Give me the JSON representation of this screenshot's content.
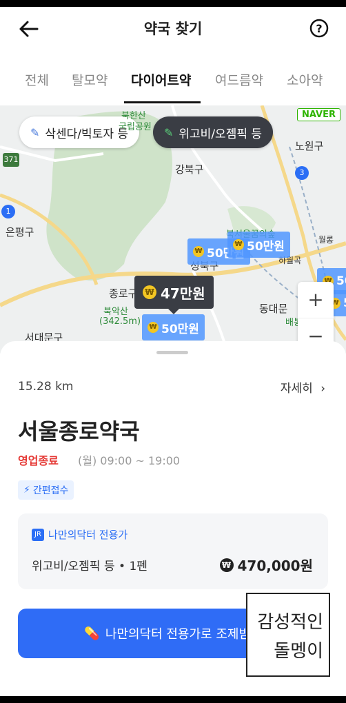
{
  "header": {
    "title": "약국 찾기",
    "back_icon": "arrow-left-icon",
    "help_icon": "question-circle-icon"
  },
  "tabs": [
    {
      "label": "전체",
      "active": false
    },
    {
      "label": "탈모약",
      "active": false
    },
    {
      "label": "다이어트약",
      "active": true
    },
    {
      "label": "여드름약",
      "active": false
    },
    {
      "label": "소아약",
      "active": false
    }
  ],
  "map": {
    "filter_chips": [
      {
        "label": "삭센다/빅토자 등",
        "selected": false
      },
      {
        "label": "위고비/오젬픽 등",
        "selected": true
      }
    ],
    "provider_badge": "NAVER",
    "labels": {
      "gangbuk": "강북구",
      "nowon": "노원구",
      "eunpyeong": "은평구",
      "seongbuk": "성북구",
      "seodaemun": "서대문구",
      "dongdaemun": "동대문",
      "jongno": "종로구",
      "bugaksan": "북악산",
      "bugaksan_height": "(342.5m)",
      "bukhansan": "북한산",
      "national_park": "국립공원",
      "forest": "북서울꿈의숲",
      "wolgye": "월롱",
      "hawolgok": "하월곡",
      "baebong": "배봉",
      "route_371": "371",
      "route_1": "1",
      "route_3": "3"
    },
    "markers": [
      {
        "label": "50만원"
      },
      {
        "label": "50만원"
      },
      {
        "label": "50만원"
      },
      {
        "label": "50"
      },
      {
        "label": "5"
      }
    ],
    "selected_marker": "47만원",
    "zoom": {
      "plus": "+",
      "minus": "−"
    }
  },
  "sheet": {
    "distance": "15.28 km",
    "detail_link": "자세히",
    "name": "서울종로약국",
    "status": "영업종료",
    "hours": "(월) 09:00 ~ 19:00",
    "badge": "간편접수",
    "price": {
      "tag": "나만의닥터 전용가",
      "item": "위고비/오젬픽 등 • 1펜",
      "amount": "470,000원"
    },
    "cta": "나만의닥터 전용가로 조제받기"
  },
  "watermark": {
    "line1": "감성적인",
    "line2": "돌멩이"
  },
  "colors": {
    "accent": "#2f6cf6",
    "closed": "#e53935",
    "marker": "#5096ff",
    "dark_marker": "#3a3d44"
  }
}
